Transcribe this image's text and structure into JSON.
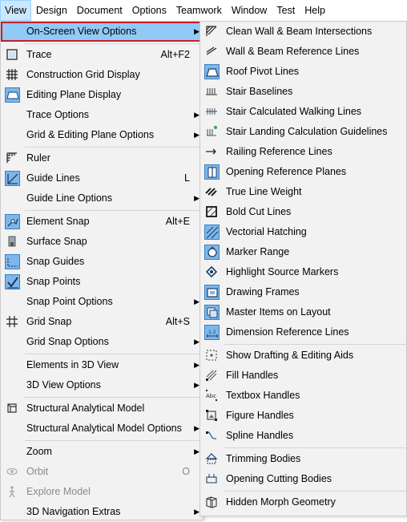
{
  "menubar": {
    "items": [
      "View",
      "Design",
      "Document",
      "Options",
      "Teamwork",
      "Window",
      "Test",
      "Help"
    ]
  },
  "view_menu": {
    "on_screen_view_options": "On-Screen View Options",
    "trace": "Trace",
    "trace_shortcut": "Alt+F2",
    "construction_grid_display": "Construction Grid Display",
    "editing_plane_display": "Editing Plane Display",
    "trace_options": "Trace Options",
    "grid_editing_plane_options": "Grid & Editing Plane Options",
    "ruler": "Ruler",
    "guide_lines": "Guide Lines",
    "guide_lines_shortcut": "L",
    "guide_line_options": "Guide Line Options",
    "element_snap": "Element Snap",
    "element_snap_shortcut": "Alt+E",
    "surface_snap": "Surface Snap",
    "snap_guides": "Snap Guides",
    "snap_points": "Snap Points",
    "snap_point_options": "Snap Point Options",
    "grid_snap": "Grid Snap",
    "grid_snap_shortcut": "Alt+S",
    "grid_snap_options": "Grid Snap Options",
    "elements_in_3d_view": "Elements in 3D View",
    "view_options_3d": "3D View Options",
    "structural_analytical_model": "Structural Analytical Model",
    "structural_analytical_model_options": "Structural Analytical Model Options",
    "zoom": "Zoom",
    "orbit": "Orbit",
    "orbit_shortcut": "O",
    "explore_model": "Explore Model",
    "navigation_extras_3d": "3D Navigation Extras"
  },
  "submenu": {
    "items": [
      "Clean Wall & Beam Intersections",
      "Wall & Beam Reference Lines",
      "Roof Pivot Lines",
      "Stair Baselines",
      "Stair Calculated Walking Lines",
      "Stair Landing Calculation Guidelines",
      "Railing Reference Lines",
      "Opening Reference Planes",
      "True Line Weight",
      "Bold Cut Lines",
      "Vectorial Hatching",
      "Marker Range",
      "Highlight Source Markers",
      "Drawing Frames",
      "Master Items on Layout",
      "Dimension Reference Lines",
      "Show Drafting & Editing Aids",
      "Fill Handles",
      "Textbox Handles",
      "Figure Handles",
      "Spline Handles",
      "Trimming Bodies",
      "Opening Cutting Bodies",
      "Hidden Morph Geometry"
    ]
  },
  "colors": {
    "highlight": "#91c9f7",
    "selection_box": "#c41e2a",
    "icon_selected": "#7eb6ea"
  }
}
